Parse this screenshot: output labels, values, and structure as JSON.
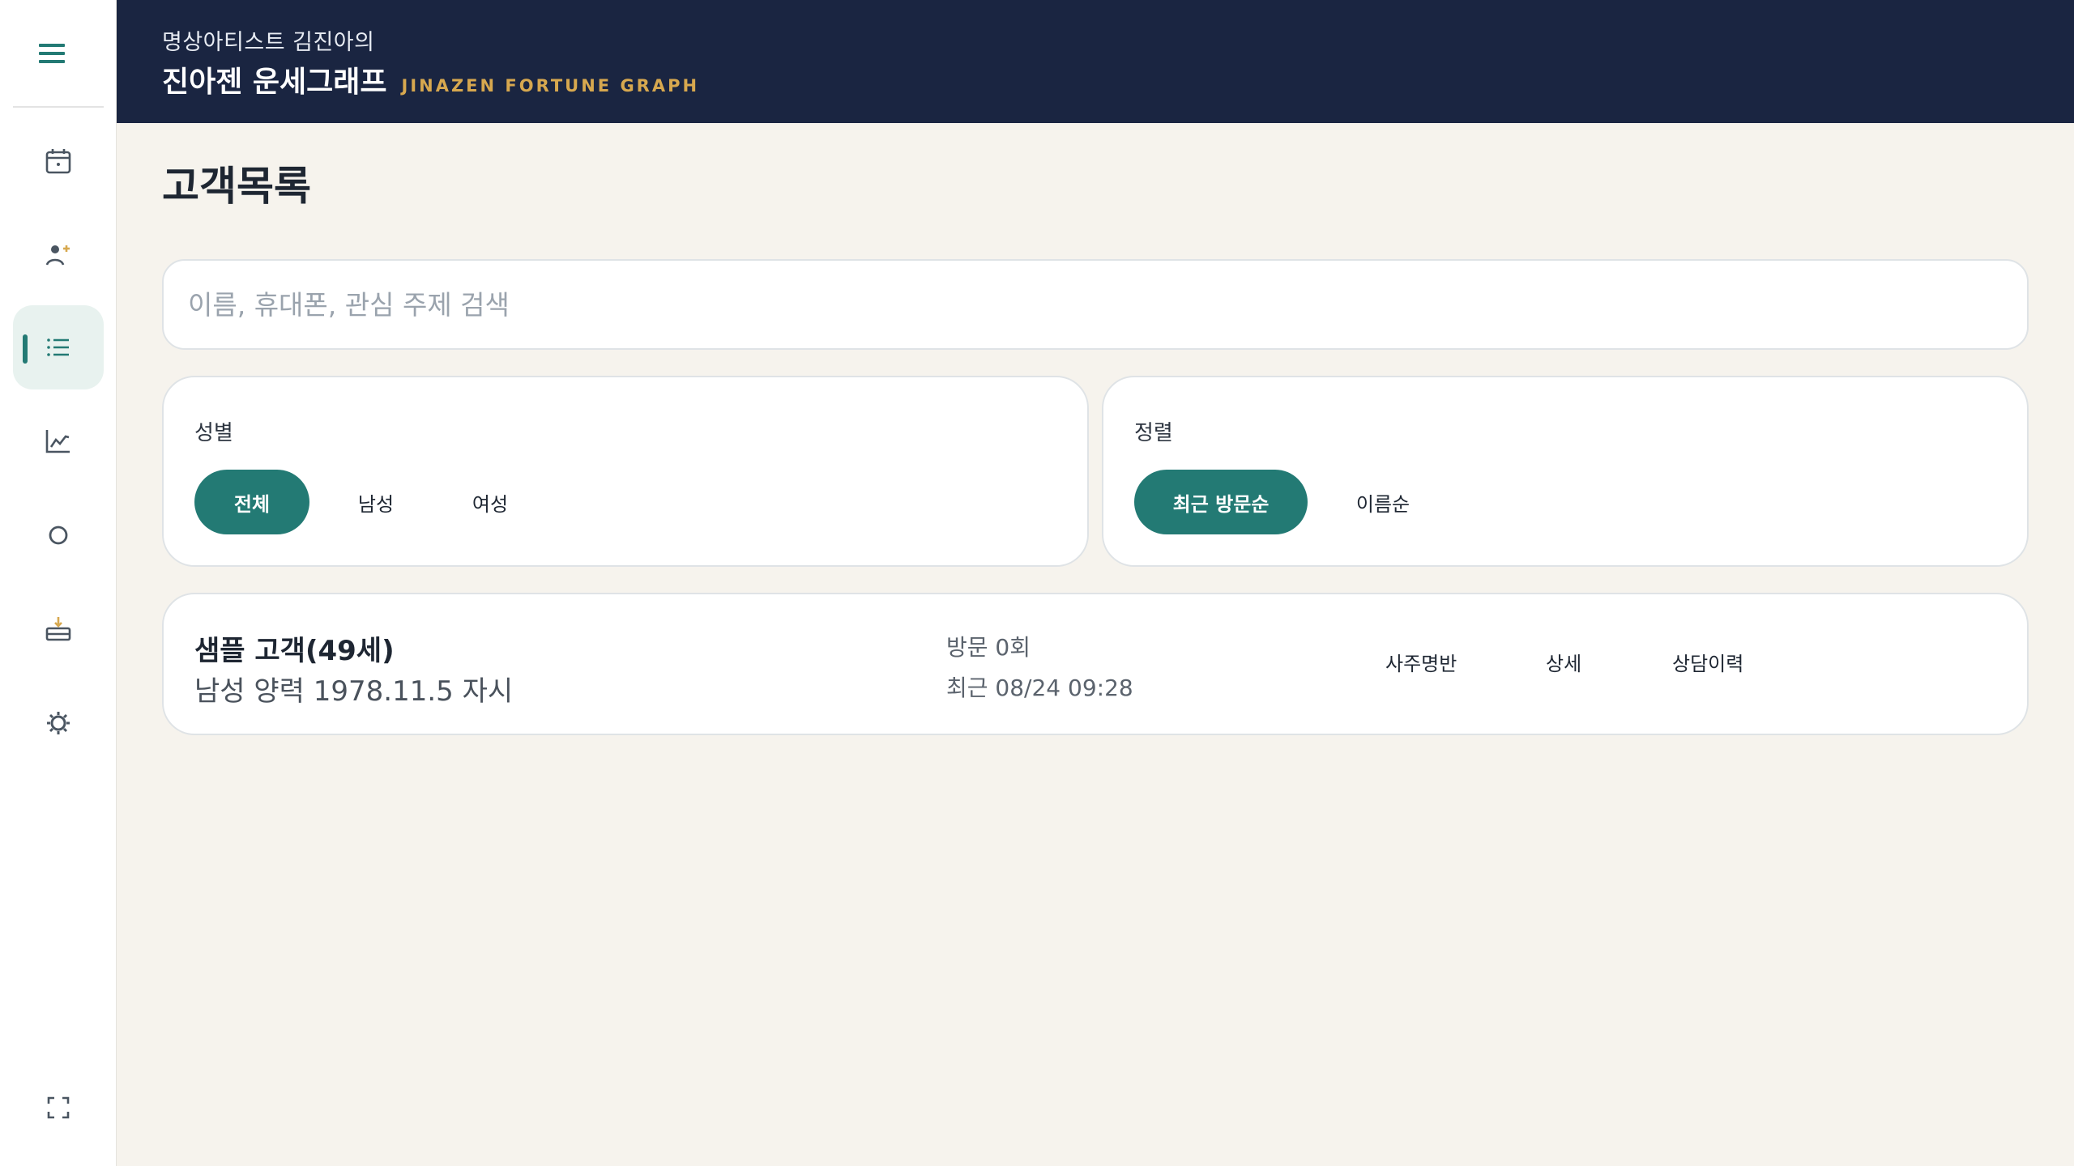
{
  "header": {
    "subtitle": "명상아티스트 김진아의",
    "title": "진아젠 운세그래프",
    "title_en": "JINAZEN FORTUNE GRAPH"
  },
  "sidebar": {
    "items": [
      {
        "icon": "calendar-icon"
      },
      {
        "icon": "add-person-icon"
      },
      {
        "icon": "list-icon",
        "active": true
      },
      {
        "icon": "chart-icon"
      },
      {
        "icon": "circle-icon"
      },
      {
        "icon": "inbox-download-icon"
      },
      {
        "icon": "settings-icon"
      }
    ]
  },
  "page": {
    "title": "고객목록"
  },
  "search": {
    "placeholder": "이름, 휴대폰, 관심 주제 검색",
    "value": ""
  },
  "filters": {
    "gender": {
      "label": "성별",
      "options": [
        "전체",
        "남성",
        "여성"
      ],
      "selected": "전체"
    },
    "sort": {
      "label": "정렬",
      "options": [
        "최근 방문순",
        "이름순"
      ],
      "selected": "최근 방문순"
    }
  },
  "customers": [
    {
      "name": "샘플 고객(49세)",
      "info": "남성 양력 1978.11.5 자시",
      "visits": "방문 0회",
      "recent": "최근 08/24 09:28",
      "actions": [
        "사주명반",
        "상세",
        "상담이력"
      ]
    }
  ],
  "colors": {
    "header_bg": "#1a2541",
    "accent": "#237a74",
    "gold": "#d7a84f",
    "page_bg": "#f6f3ed"
  }
}
